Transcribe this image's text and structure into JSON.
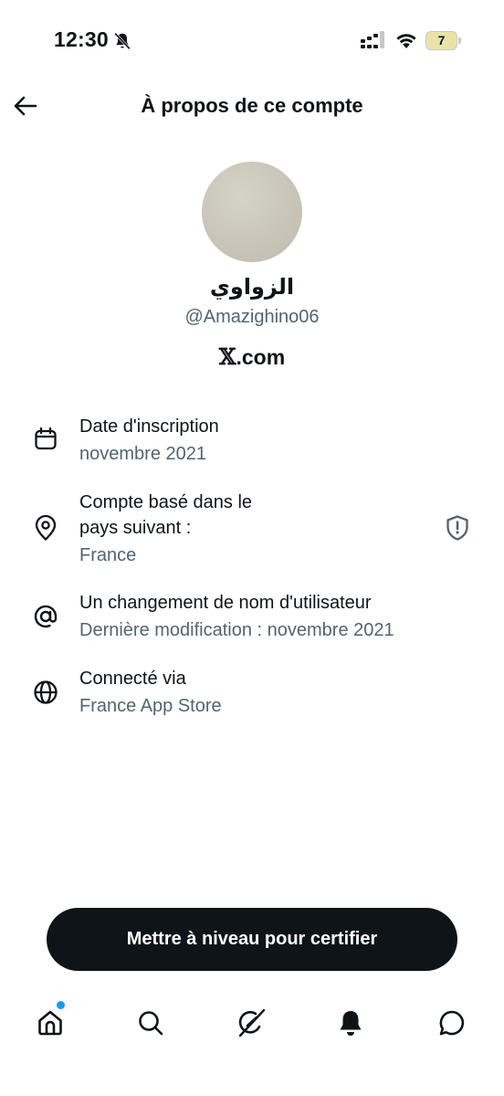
{
  "status_bar": {
    "time": "12:30",
    "battery_level": "7",
    "icons": [
      "bell-off-icon",
      "signal-icon",
      "wifi-icon",
      "battery-icon"
    ]
  },
  "header": {
    "title": "À propos de ce compte",
    "back_icon": "arrow-left-icon"
  },
  "profile": {
    "display_name": "الزواوي",
    "handle": "@Amazighino06",
    "platform_logo": "𝕏",
    "platform_suffix": ".com"
  },
  "info_rows": [
    {
      "icon": "calendar-icon",
      "title": "Date d'inscription",
      "value": "novembre 2021"
    },
    {
      "icon": "location-pin-icon",
      "title_line1": "Compte basé dans le",
      "title_line2": "pays suivant :",
      "value": "France",
      "action_icon": "shield-icon"
    },
    {
      "icon": "at-sign-icon",
      "title": "Un changement de nom d'utilisateur",
      "value": "Dernière modification : novembre 2021"
    },
    {
      "icon": "globe-icon",
      "title": "Connecté via",
      "value": "France App Store"
    }
  ],
  "cta": {
    "label": "Mettre à niveau pour certifier"
  },
  "bottom_nav": {
    "items": [
      "home-icon",
      "search-icon",
      "grok-icon",
      "notifications-icon",
      "messages-icon"
    ],
    "home_has_badge": true
  },
  "colors": {
    "text_primary": "#0f1419",
    "text_secondary": "#536471",
    "button_bg": "#0f1419",
    "badge_blue": "#1d9bf0",
    "battery_fill": "#e9e4a6"
  }
}
